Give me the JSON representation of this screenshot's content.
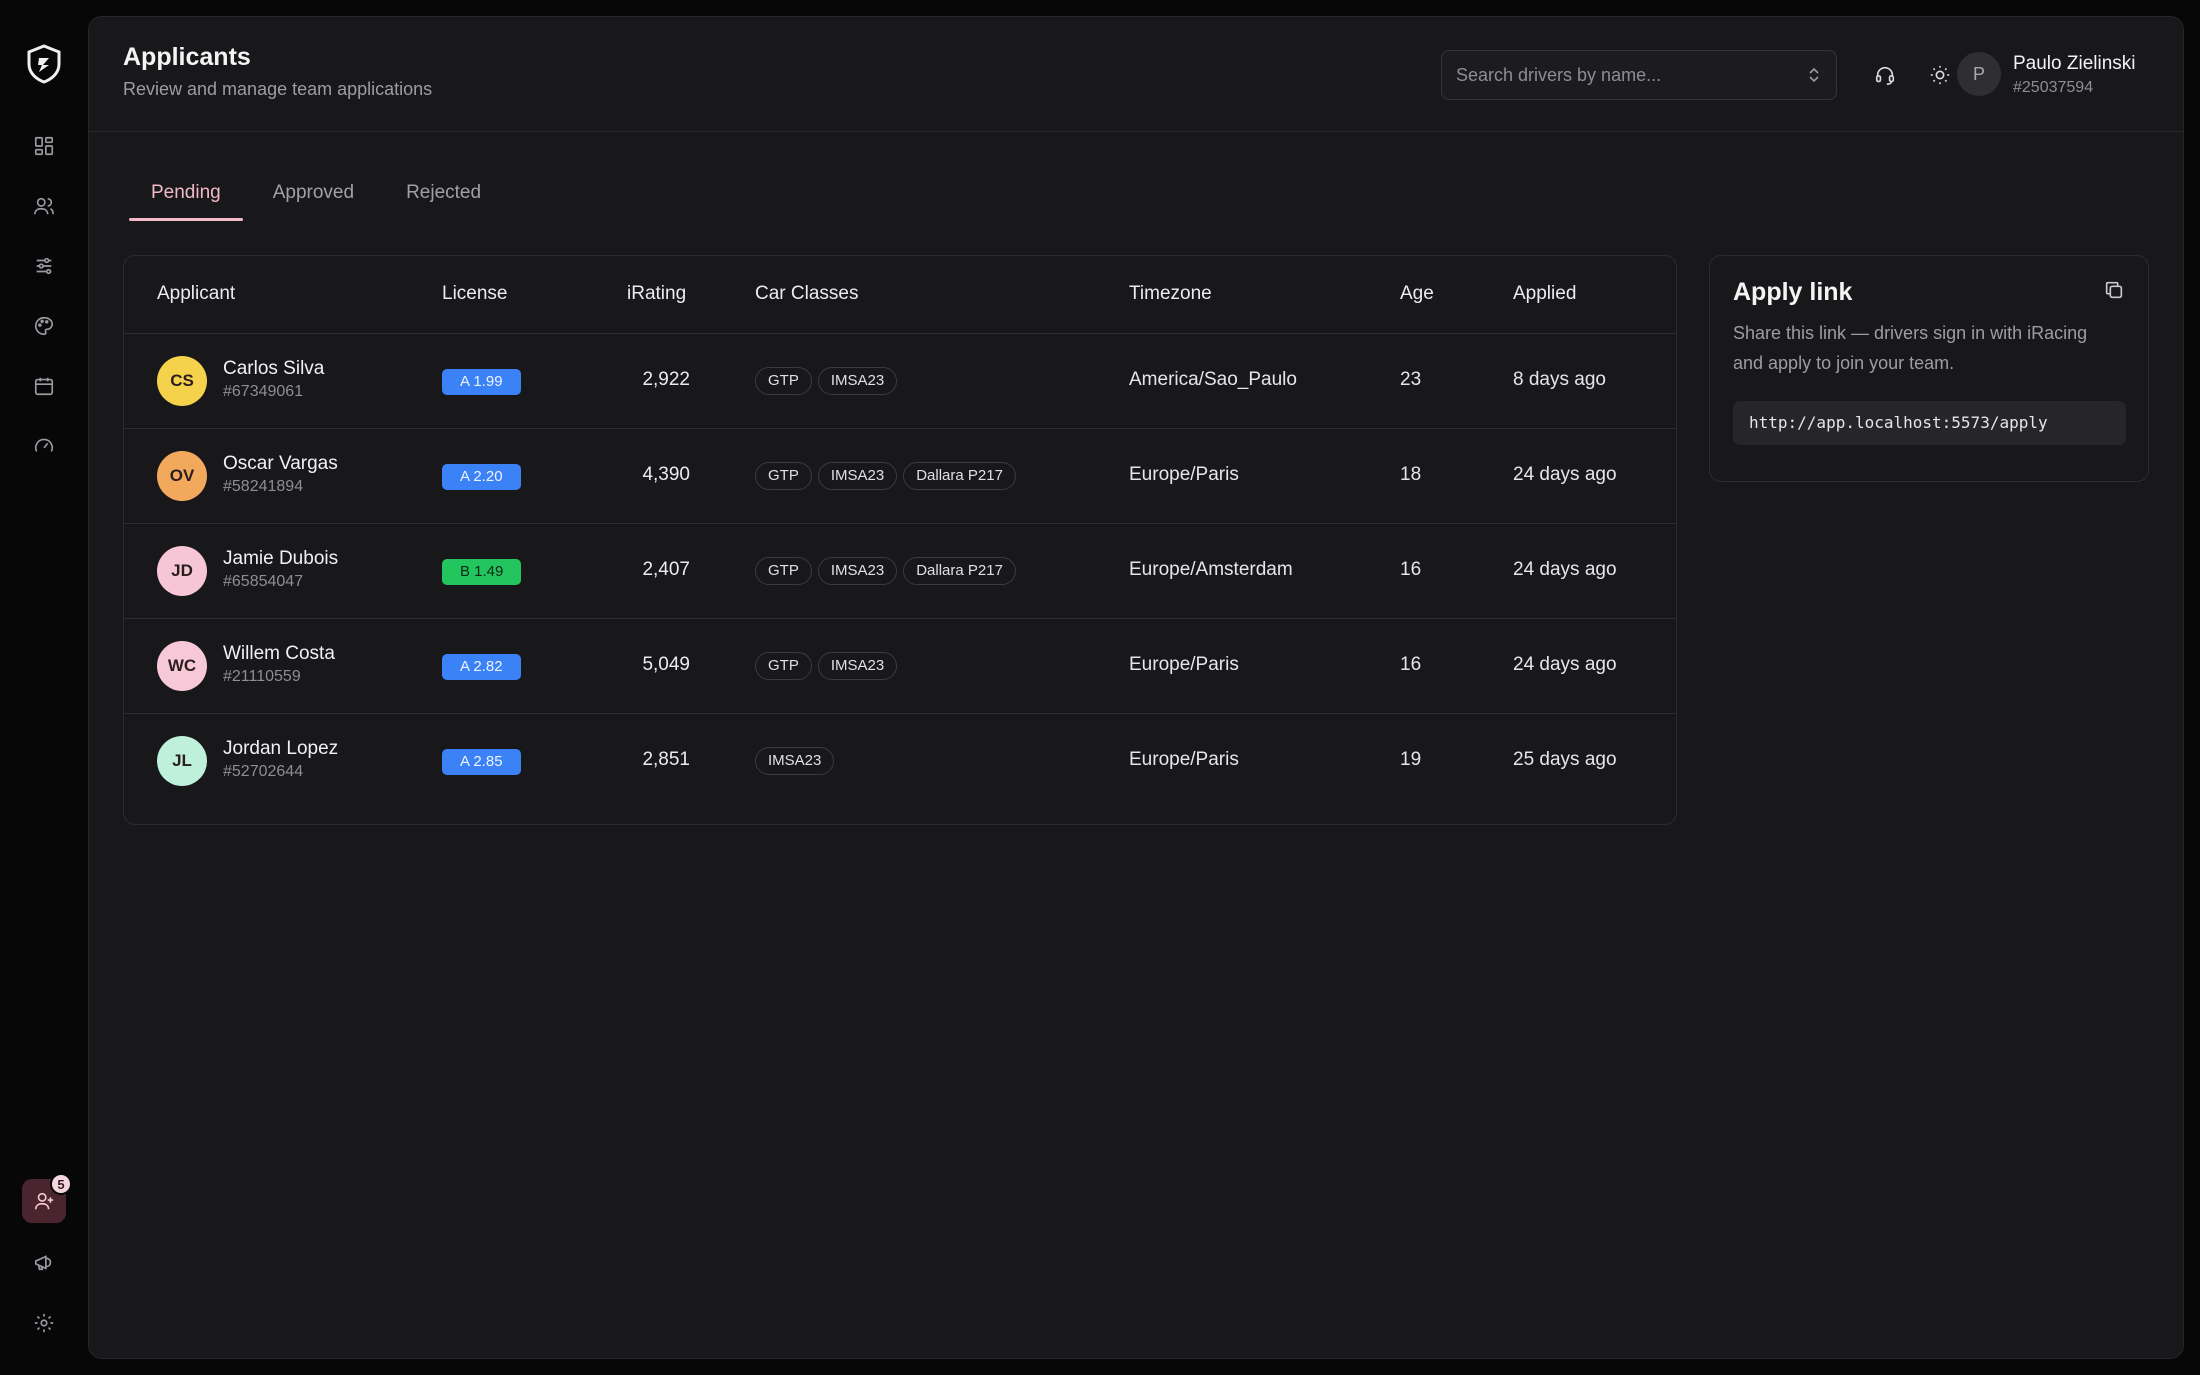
{
  "header": {
    "title": "Applicants",
    "subtitle": "Review and manage team applications",
    "search_placeholder": "Search drivers by name...",
    "user": {
      "initial": "P",
      "name": "Paulo Zielinski",
      "id": "#25037594"
    }
  },
  "rail": {
    "badge_count": "5"
  },
  "tabs": [
    {
      "label": "Pending",
      "active": true
    },
    {
      "label": "Approved",
      "active": false
    },
    {
      "label": "Rejected",
      "active": false
    }
  ],
  "table": {
    "headers": [
      "Applicant",
      "License",
      "iRating",
      "Car Classes",
      "Timezone",
      "Age",
      "Applied"
    ],
    "rows": [
      {
        "initials": "CS",
        "avatar_color": "#f5d24b",
        "name": "Carlos Silva",
        "id": "#67349061",
        "license": "A 1.99",
        "license_class": "a",
        "irating": "2,922",
        "classes": [
          "GTP",
          "IMSA23"
        ],
        "timezone": "America/Sao_Paulo",
        "age": "23",
        "applied": "8 days ago"
      },
      {
        "initials": "OV",
        "avatar_color": "#f3a95c",
        "name": "Oscar Vargas",
        "id": "#58241894",
        "license": "A 2.20",
        "license_class": "a",
        "irating": "4,390",
        "classes": [
          "GTP",
          "IMSA23",
          "Dallara P217"
        ],
        "timezone": "Europe/Paris",
        "age": "18",
        "applied": "24 days ago"
      },
      {
        "initials": "JD",
        "avatar_color": "#f6c6d7",
        "name": "Jamie Dubois",
        "id": "#65854047",
        "license": "B 1.49",
        "license_class": "b",
        "irating": "2,407",
        "classes": [
          "GTP",
          "IMSA23",
          "Dallara P217"
        ],
        "timezone": "Europe/Amsterdam",
        "age": "16",
        "applied": "24 days ago"
      },
      {
        "initials": "WC",
        "avatar_color": "#f7c9d8",
        "name": "Willem Costa",
        "id": "#21110559",
        "license": "A 2.82",
        "license_class": "a",
        "irating": "5,049",
        "classes": [
          "GTP",
          "IMSA23"
        ],
        "timezone": "Europe/Paris",
        "age": "16",
        "applied": "24 days ago"
      },
      {
        "initials": "JL",
        "avatar_color": "#bff0dc",
        "name": "Jordan Lopez",
        "id": "#52702644",
        "license": "A 2.85",
        "license_class": "a",
        "irating": "2,851",
        "classes": [
          "IMSA23"
        ],
        "timezone": "Europe/Paris",
        "age": "19",
        "applied": "25 days ago"
      }
    ]
  },
  "apply": {
    "title": "Apply link",
    "description": "Share this link — drivers sign in with iRacing and apply to join your team.",
    "url": "http://app.localhost:5573/apply"
  },
  "colors": {
    "accent": "#f3b9c8",
    "license_a": "#3b82f6",
    "license_b": "#22c55e"
  }
}
